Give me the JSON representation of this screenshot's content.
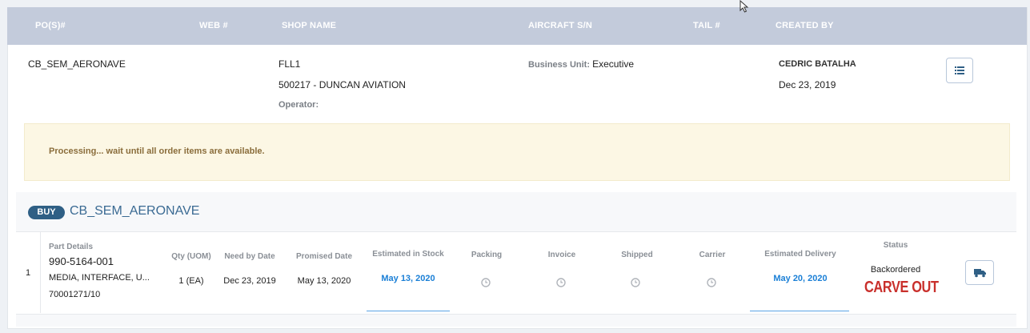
{
  "header": {
    "pos": "PO(S)#",
    "web": "WEB #",
    "shop_name": "SHOP NAME",
    "aircraft_sn": "AIRCRAFT S/N",
    "tail": "TAIL #",
    "created_by": "CREATED BY"
  },
  "order": {
    "po": "CB_SEM_AERONAVE",
    "shop_code": "FLL1",
    "shop_full": "500217 - DUNCAN AVIATION",
    "operator_label": "Operator:",
    "business_unit_label": "Business Unit:",
    "business_unit_value": "Executive",
    "created_by_name": "CEDRIC BATALHA",
    "created_date": "Dec 23, 2019"
  },
  "alert": {
    "message": "Processing... wait until all order items are available."
  },
  "section": {
    "badge": "BUY",
    "title": "CB_SEM_AERONAVE"
  },
  "columns": {
    "part_details": "Part Details",
    "qty": "Qty (UOM)",
    "need_by": "Need by Date",
    "promised": "Promised Date",
    "est_stock": "Estimated in Stock",
    "packing": "Packing",
    "invoice": "Invoice",
    "shipped": "Shipped",
    "carrier": "Carrier",
    "est_delivery": "Estimated Delivery",
    "status": "Status"
  },
  "line": {
    "index": "1",
    "part_number": "990-5164-001",
    "description": "MEDIA, INTERFACE, U...",
    "ref": "70001271/10",
    "qty": "1 (EA)",
    "need_by": "Dec 23, 2019",
    "promised": "May 13, 2020",
    "est_stock": "May 13, 2020",
    "est_delivery": "May 20, 2020",
    "status": "Backordered",
    "stamp": "CARVE OUT"
  },
  "colors": {
    "header_bg": "#c3cbdb",
    "link": "#1a7fd6",
    "badge": "#2f5f85",
    "alert_bg": "#fcf7e4",
    "alert_text": "#8a6d3b",
    "stamp": "#c9302c"
  },
  "icons": [
    "list-icon",
    "clock-icon",
    "truck-icon",
    "cursor-icon"
  ]
}
